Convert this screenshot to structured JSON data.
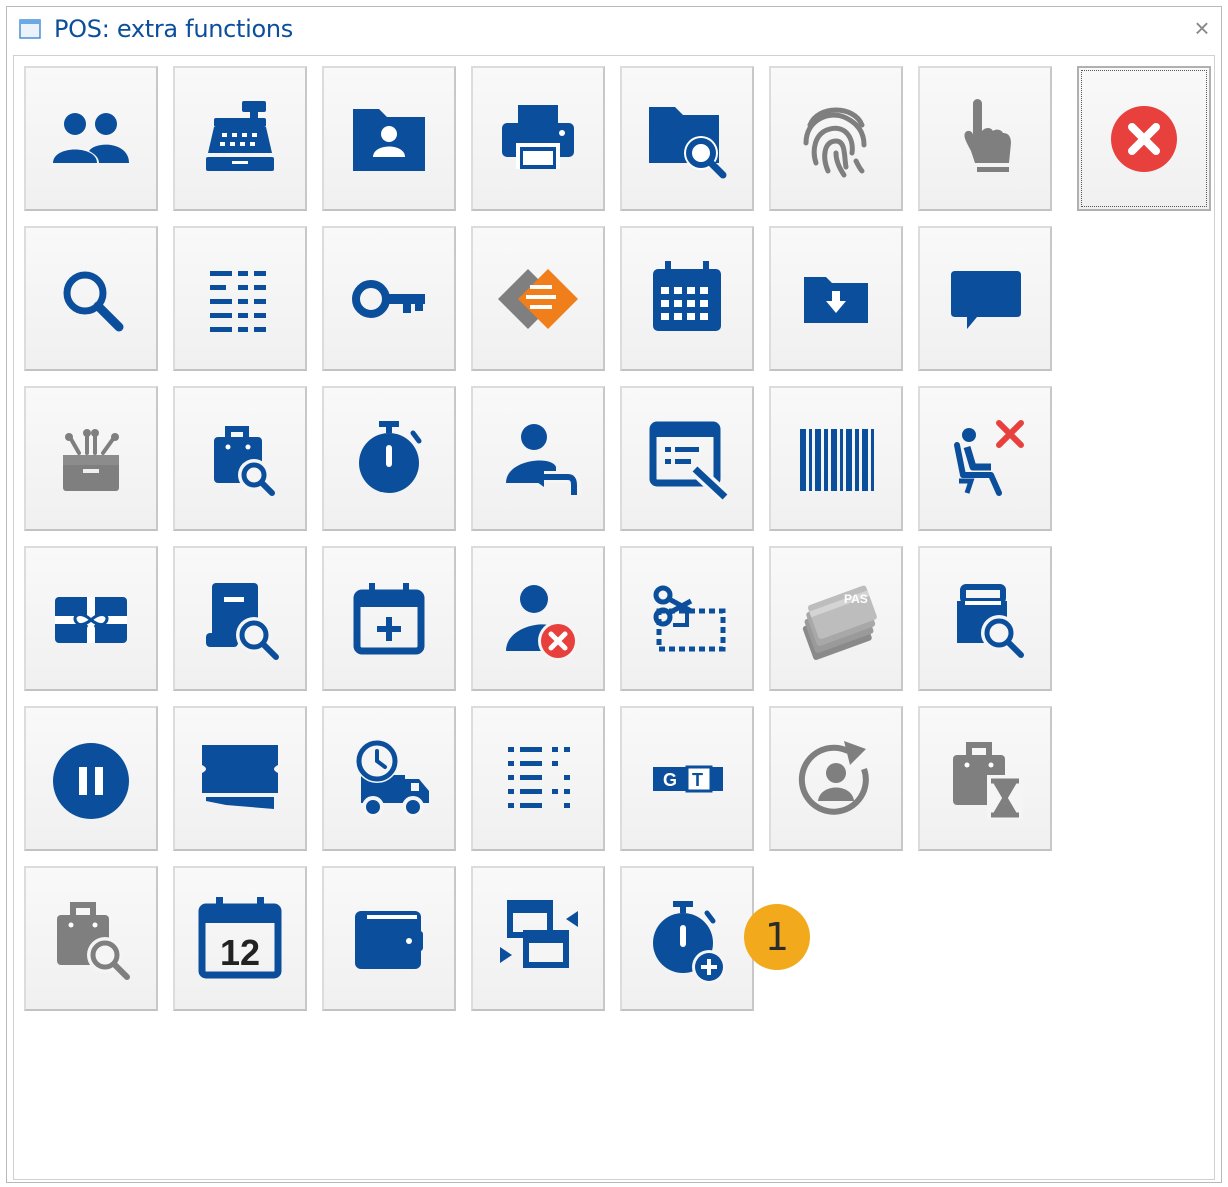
{
  "window": {
    "title": "POS: extra functions",
    "close_glyph": "×"
  },
  "colors": {
    "blue": "#0b4f9c",
    "grey": "#7f7f7f",
    "red": "#e8403c",
    "orange": "#f07e1b",
    "badge": "#f2aa1c"
  },
  "badge": {
    "value": "1"
  },
  "buttons": [
    {
      "row": 1,
      "icon": "customers-icon"
    },
    {
      "row": 1,
      "icon": "cash-register-icon"
    },
    {
      "row": 1,
      "icon": "contact-folder-icon"
    },
    {
      "row": 1,
      "icon": "printer-icon"
    },
    {
      "row": 1,
      "icon": "folder-search-icon"
    },
    {
      "row": 1,
      "icon": "fingerprint-icon"
    },
    {
      "row": 1,
      "icon": "hand-pointer-icon"
    },
    {
      "row": 1,
      "icon": "close-circle-icon"
    },
    {
      "row": 2,
      "icon": "search-icon"
    },
    {
      "row": 2,
      "icon": "list-details-icon"
    },
    {
      "row": 2,
      "icon": "key-icon"
    },
    {
      "row": 2,
      "icon": "diamond-exchange-icon"
    },
    {
      "row": 2,
      "icon": "calendar-grid-icon"
    },
    {
      "row": 2,
      "icon": "folder-download-icon"
    },
    {
      "row": 2,
      "icon": "chat-bubble-icon"
    },
    {
      "row": 3,
      "icon": "gift-box-icon"
    },
    {
      "row": 3,
      "icon": "bag-search-icon"
    },
    {
      "row": 3,
      "icon": "stopwatch-icon"
    },
    {
      "row": 3,
      "icon": "user-return-icon"
    },
    {
      "row": 3,
      "icon": "form-edit-icon"
    },
    {
      "row": 3,
      "icon": "barcode-icon"
    },
    {
      "row": 3,
      "icon": "seat-cancel-icon"
    },
    {
      "row": 4,
      "icon": "gift-card-icon"
    },
    {
      "row": 4,
      "icon": "document-search-icon"
    },
    {
      "row": 4,
      "icon": "calendar-add-icon"
    },
    {
      "row": 4,
      "icon": "user-remove-icon"
    },
    {
      "row": 4,
      "icon": "cut-coupon-icon"
    },
    {
      "row": 4,
      "icon": "cards-stack-icon"
    },
    {
      "row": 4,
      "icon": "box-search-icon"
    },
    {
      "row": 5,
      "icon": "pause-icon"
    },
    {
      "row": 5,
      "icon": "ticket-icon"
    },
    {
      "row": 5,
      "icon": "delivery-truck-icon"
    },
    {
      "row": 5,
      "icon": "dotted-list-icon"
    },
    {
      "row": 5,
      "icon": "gt-tag-icon"
    },
    {
      "row": 5,
      "icon": "user-refresh-icon"
    },
    {
      "row": 5,
      "icon": "bag-hourglass-icon"
    },
    {
      "row": 6,
      "icon": "bag-search-grey-icon"
    },
    {
      "row": 6,
      "icon": "calendar-day-icon",
      "text": "12"
    },
    {
      "row": 6,
      "icon": "wallet-icon"
    },
    {
      "row": 6,
      "icon": "transfer-icon"
    },
    {
      "row": 6,
      "icon": "stopwatch-add-icon"
    }
  ],
  "card_label": "PAS",
  "gt_letters": [
    "G",
    "T"
  ]
}
